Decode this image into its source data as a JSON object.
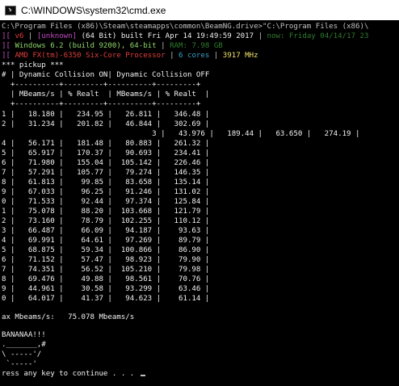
{
  "window": {
    "title": "C:\\WINDOWS\\system32\\cmd.exe"
  },
  "console": {
    "cmd_line": "C:\\Program Files (x86)\\Steam\\steamapps\\common\\BeamNG.drive>\"C:\\Program Files (x86)\\",
    "info1": [
      {
        "t": "][ ",
        "c": "c-magenta"
      },
      {
        "t": "v6",
        "c": "c-red"
      },
      {
        "t": " | ",
        "c": "c-gray"
      },
      {
        "t": "[unknown]",
        "c": "c-magenta"
      },
      {
        "t": " (64 Bit) built Fri Apr 14 19:49:59 2017",
        "c": "c-white"
      },
      {
        "t": " | ",
        "c": "c-gray"
      },
      {
        "t": "now: Friday 04/14/17 23",
        "c": "c-dkgreen"
      }
    ],
    "info2": [
      {
        "t": "][ ",
        "c": "c-magenta"
      },
      {
        "t": "Windows 6.2 (build 9200), 64-bit",
        "c": "c-lgreen"
      },
      {
        "t": " | ",
        "c": "c-gray"
      },
      {
        "t": "RAM: 7.98 GB",
        "c": "c-dkgreen"
      }
    ],
    "info3": [
      {
        "t": "][ ",
        "c": "c-magenta"
      },
      {
        "t": "AMD FX(tm)-6350 Six-Core Processor",
        "c": "c-red"
      },
      {
        "t": " | ",
        "c": "c-gray"
      },
      {
        "t": "6 cores",
        "c": "c-cyan"
      },
      {
        "t": " | ",
        "c": "c-gray"
      },
      {
        "t": "3917 MHz",
        "c": "c-yellow"
      }
    ],
    "scenario": "*** pickup ***",
    "header1": "# | Dynamic Collision ON| Dynamic Collision OFF",
    "sep1": "  +----------+---------+----------+---------+",
    "header2": "  | MBeams/s | % Realt  | MBeams/s | % Realt  |",
    "sep2": "  +----------+---------+----------+---------+",
    "rows": [
      "1 |   18.180 |   234.95 |   26.811 |   346.48 |",
      "2 |   31.234 |   201.82 |   46.844 |   302.69 |",
      "                                  3 |   43.976 |   189.44 |   63.650 |   274.19 |",
      "4 |   56.171 |   181.48 |   80.883 |   261.32 |",
      "5 |   65.917 |   170.37 |   90.693 |   234.41 |",
      "6 |   71.980 |   155.04 |  105.142 |   226.46 |",
      "7 |   57.291 |   105.77 |   79.274 |   146.35 |",
      "8 |   61.813 |    99.85 |   83.658 |   135.14 |",
      "9 |   67.033 |    96.25 |   91.246 |   131.02 |",
      "0 |   71.533 |    92.44 |   97.374 |   125.84 |",
      "1 |   75.078 |    88.20 |  103.668 |   121.79 |",
      "2 |   73.160 |    78.79 |  102.255 |   110.12 |",
      "3 |   66.487 |    66.09 |   94.187 |    93.63 |",
      "4 |   69.991 |    64.61 |   97.269 |    89.79 |",
      "5 |   68.875 |    59.34 |  100.866 |    86.90 |",
      "6 |   71.152 |    57.47 |   98.923 |    79.90 |",
      "7 |   74.351 |    56.52 |  105.210 |    79.98 |",
      "8 |   69.476 |    49.88 |   98.561 |    70.76 |",
      "9 |   44.961 |    30.58 |   93.299 |    63.46 |",
      "0 |   64.017 |    41.37 |   94.623 |    61.14 |"
    ],
    "max_line": "ax Mbeams/s:   75.078 Mbeams/s",
    "banana": "BANANAA!!!",
    "art1": "._______,#",
    "art2": "\\ -----'/",
    "art3": " `-----'",
    "prompt": "ress any key to continue . . . "
  }
}
